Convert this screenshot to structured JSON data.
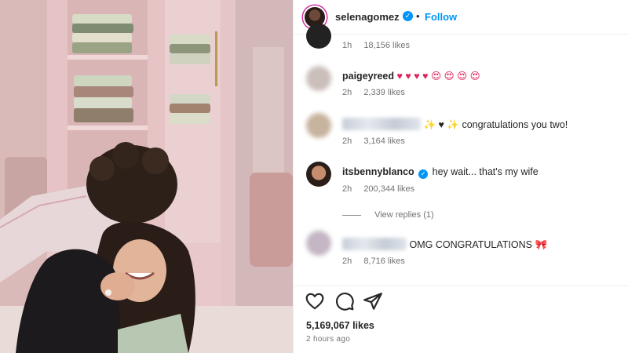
{
  "post": {
    "username": "selenagomez",
    "separator": "•",
    "follow_label": "Follow",
    "likes_text": "5,169,067 likes",
    "posted_time": "2 hours ago"
  },
  "comments": [
    {
      "id": "c0",
      "username": "",
      "text": "",
      "time": "1h",
      "likes": "18,156 likes"
    },
    {
      "id": "c1",
      "username": "paigeyreed",
      "text": "♥ ♥ ♥ ♥ 😍 😍 😍 😍",
      "time": "2h",
      "likes": "2,339 likes"
    },
    {
      "id": "c2",
      "username": "",
      "text": "✨ ♥ ✨ congratulations you two!",
      "time": "2h",
      "likes": "3,164 likes"
    },
    {
      "id": "c3",
      "username": "itsbennyblanco",
      "text": "hey wait... that's my wife",
      "time": "2h",
      "likes": "200,344 likes",
      "view_replies": "View replies (1)"
    },
    {
      "id": "c4",
      "username": "",
      "text": "OMG CONGRATULATIONS 🎀",
      "time": "2h",
      "likes": "8,716 likes"
    }
  ],
  "icons": [
    "heart-icon",
    "comment-icon",
    "share-icon",
    "verified-badge-icon"
  ],
  "colors": {
    "accent": "#0095f6",
    "secondary_text": "#737373",
    "heart": "#e0245e"
  }
}
